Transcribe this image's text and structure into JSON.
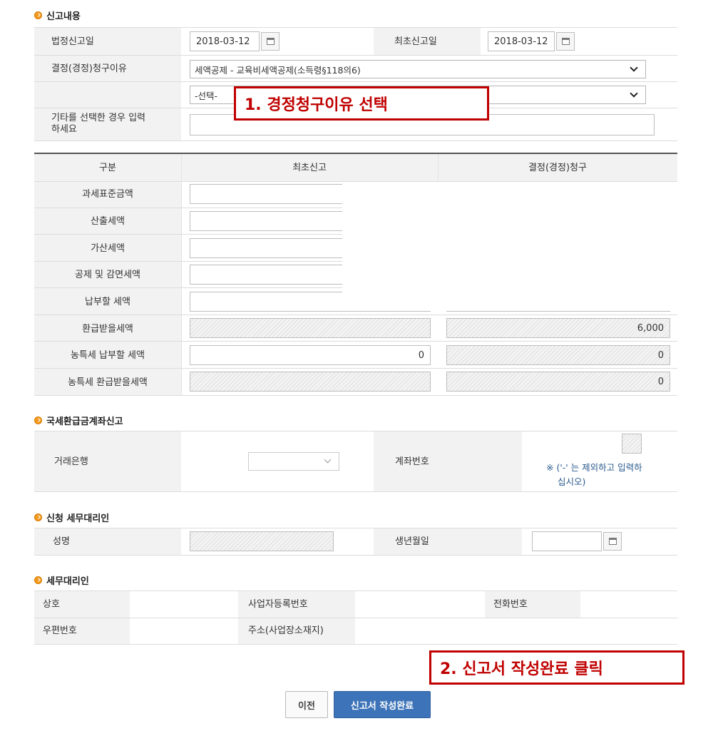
{
  "report": {
    "title": "신고내용",
    "legal_date_label": "법정신고일",
    "legal_date_value": "2018-03-12",
    "first_date_label": "최초신고일",
    "first_date_value": "2018-03-12",
    "reason_label": "결정(경정)청구이유",
    "reason_select_value": "세액공제 - 교육비세액공제(소득령§118의6)",
    "reason_sub_select_value": "-선택-",
    "other_label_line1": "기타를 선택한 경우 입력",
    "other_label_line2": "하세요",
    "other_value": ""
  },
  "amounts": {
    "header_category": "구분",
    "header_first": "최초신고",
    "header_claim": "결정(경정)청구",
    "rows": [
      {
        "label": "과세표준금액",
        "first": "",
        "claim": ""
      },
      {
        "label": "산출세액",
        "first": "",
        "claim": ""
      },
      {
        "label": "가산세액",
        "first": "",
        "claim": ""
      },
      {
        "label": "공제 및 감면세액",
        "first": "",
        "claim": ""
      },
      {
        "label": "납부할 세액",
        "first": "",
        "claim": ""
      },
      {
        "label": "환급받을세액",
        "first": "",
        "claim": "6,000"
      },
      {
        "label": "농특세 납부할 세액",
        "first": "0",
        "claim": "0"
      },
      {
        "label": "농특세 환급받을세액",
        "first": "",
        "claim": "0"
      }
    ]
  },
  "refund_account": {
    "title": "국세환급금계좌신고",
    "bank_label": "거래은행",
    "bank_value": "",
    "account_label": "계좌번호",
    "account_value": "",
    "note_line1": "※ ('-' 는 제외하고 입력하",
    "note_line2": "십시오)"
  },
  "agent_applicant": {
    "title": "신청 세무대리인",
    "name_label": "성명",
    "name_value": "",
    "birth_label": "생년월일",
    "birth_value": ""
  },
  "agent": {
    "title": "세무대리인",
    "firm_label": "상호",
    "bizno_label": "사업자등록번호",
    "phone_label": "전화번호",
    "zip_label": "우편번호",
    "address_label": "주소(사업장소재지)"
  },
  "annotations": {
    "step1": "1. 경정청구이유 선택",
    "step2": "2. 신고서 작성완료 클릭"
  },
  "buttons": {
    "prev": "이전",
    "submit": "신고서 작성완료"
  },
  "colors": {
    "accent_orange": "#f29a1f",
    "annotation_red": "#c00000",
    "submit_blue": "#3d73b8"
  }
}
